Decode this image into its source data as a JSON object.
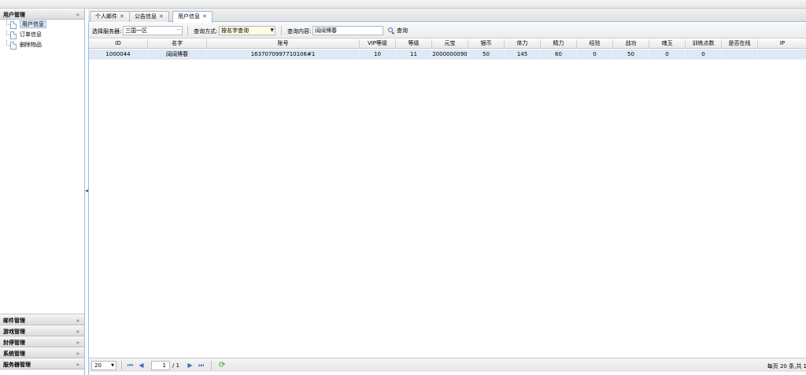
{
  "sidebar": {
    "sections": [
      {
        "title": "用户管理",
        "expanded": true,
        "items": [
          "用户信息",
          "订单信息",
          "删除物品"
        ],
        "selected": 0
      },
      {
        "title": "邮件管理"
      },
      {
        "title": "游戏管理"
      },
      {
        "title": "封停管理"
      },
      {
        "title": "系统管理"
      },
      {
        "title": "服务器管理"
      }
    ]
  },
  "tabs": [
    {
      "label": "个人邮件",
      "active": false
    },
    {
      "label": "公告信息",
      "active": false
    },
    {
      "label": "用户信息",
      "active": true
    }
  ],
  "toolbar": {
    "server_label": "选择服务器:",
    "server_value": "三国一区",
    "method_label": "查询方式:",
    "method_value": "按名字查询",
    "content_label": "查询内容:",
    "content_value": "阔阔博春",
    "search_label": "查询"
  },
  "grid": {
    "columns": [
      "ID",
      "名字",
      "账号",
      "VIP等级",
      "等级",
      "元宝",
      "银币",
      "体力",
      "精力",
      "经验",
      "战功",
      "魂玉",
      "训练点数",
      "是否在线",
      "IP"
    ],
    "rows": [
      [
        "1000044",
        "阔阔博春",
        "1637070997710106#1",
        "10",
        "11",
        "2000000090",
        "50",
        "145",
        "60",
        "0",
        "50",
        "0",
        "0",
        "",
        ""
      ]
    ]
  },
  "pager": {
    "page_size": "20",
    "current_page": "1",
    "total_pages": "/ 1",
    "info": "每页 20 条,共 1"
  }
}
